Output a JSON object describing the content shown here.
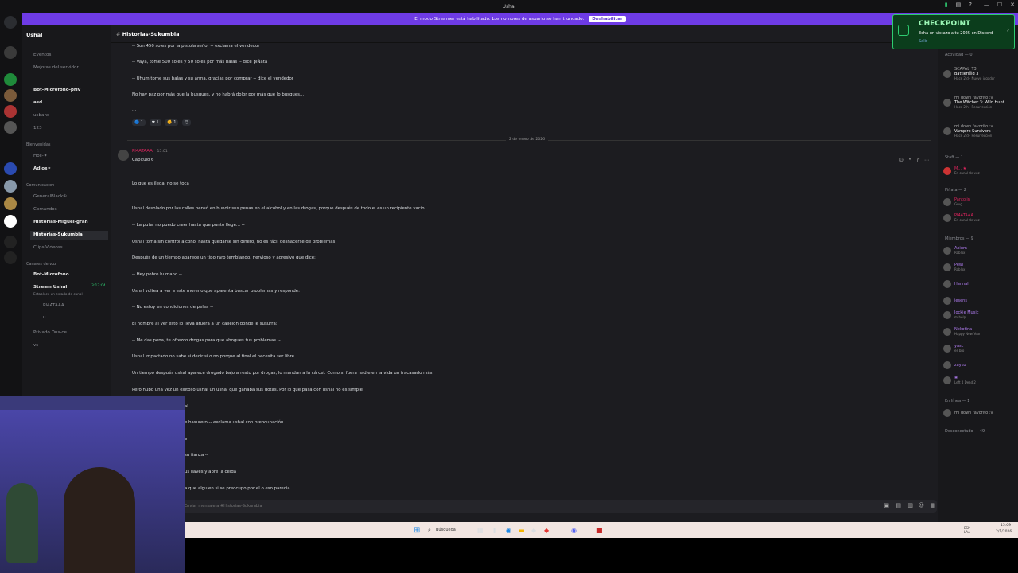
{
  "titlebar": {
    "title": "Ushal"
  },
  "banner": {
    "text": "El modo Streamer está habilitado. Los nombres de usuario se han truncado.",
    "button": "Deshabilitar"
  },
  "server": {
    "name": "Ushal"
  },
  "sidebar": {
    "top": [
      "Eventos",
      "Mejoras del servidor"
    ],
    "channels": [
      "Bot-Microfono-priv",
      "asd",
      "usbans",
      "123"
    ],
    "cat_bienvenidas": "Bienvenidas",
    "bienvenidas": [
      "Holi-✦",
      "Adios✦"
    ],
    "cat_comunicacion": "Comunicacion",
    "comunicacion": [
      "GeneralBlack♔",
      "Comandos",
      "Historias-Miguel-gran",
      "Historias-Sukumbia",
      "Clips-Videoss"
    ],
    "cat_voz": "Canales de voz",
    "voz": [
      "Bot-Microfono",
      "Stream Ushal",
      "Privado Dus-ce",
      "vs"
    ],
    "voz_status": "Establece un estado de canal",
    "voz_users": [
      "PI4ATAAA",
      "u..."
    ],
    "stream_time": "3:17:04"
  },
  "channel": {
    "name": "Historias-Sukumbia",
    "input_placeholder": "Enviar mensaje a #Historias-Sukumbia"
  },
  "messages_top": [
    "-- Son 450 soles por la pistola señor -- exclama el vendedor",
    "-- Vaya, tome 500 soles y 50 soles por más balas -- dice piÑata",
    "-- Uhum tome sus balas y su arma, gracias por comprar -- dice el vendedor",
    "No hay paz por más que la busques, y no habrá dolor por más que lo busques...",
    "..."
  ],
  "reactions": [
    "1",
    "1",
    "1"
  ],
  "date_divider": "2 de enero de 2026",
  "post": {
    "author": "PI4ATAAA",
    "time": "15:01",
    "lines": [
      "Capitulo 6",
      "Lo que es ilegal no se toca",
      "Ushal desolado por las calles pensó en hundir sus penas en el alcohol y en las drogas, porque después de todo el es un recipiente vacio",
      "-- La puta, no puedo creer hasta que punto llege... --",
      "Ushal toma sin control alcohol hasta quedarse sin dinero, no es fácil deshacerse de problemas",
      "Después de un tiempo aparece un tipo raro temblando, nervioso y agresivo que dice:",
      "-- Hey pobre humano --",
      "Ushal voltea a ver a este moreno que aparenta buscar problemas y responde:",
      "-- No estoy en condiciones de pelea --",
      "El hombre al ver esto lo lleva afuera a un callejón donde le susurra:",
      "-- Me das pena, te ofrezco drogas para que ahogues tus problemas --",
      "Ushal impactado no sabe si decir si o no porque al final el necesita ser libre",
      "Un tiempo después ushal aparece drogado bajo arresto por drogas, lo mandan a la cárcel. Como si fuera nadie en la vida un fracasado más.",
      "Pero hubo una vez un exitoso ushal un ushal que ganaba sus dotas. Por lo que pasa con ushal no es simple",
      "al",
      "e basurero -- exclama ushal con preocupación",
      "e:",
      "su fianza --",
      "us llaves y abre la celda",
      "a que alguien si se preocupo por el o eso parecia..."
    ]
  },
  "checkpoint": {
    "title": "CHECKPOINT",
    "subtitle": "Echa un vistazo a tu 2025 en Discord",
    "link": "Salir"
  },
  "members": {
    "activity_header": "Actividad — 0",
    "activity": [
      {
        "name": "SCAPAL_T3",
        "game": "Battlefield 3",
        "sub": "Hace 2 d · Nuevo jugador"
      },
      {
        "name": "mi down favorito :v",
        "game": "The Witcher 3: Wild Hunt",
        "sub": "Hace 2 h · Resurrección"
      },
      {
        "name": "mi down favorito :v",
        "game": "Vampire Survivors",
        "sub": "Hace 2 d · Resurrección"
      }
    ],
    "staff_header": "Staff — 1",
    "staff": [
      {
        "name": "M... ★",
        "sub": "En canal de voz"
      }
    ],
    "pinata_header": "Piñata — 2",
    "pinata": [
      {
        "name": "Pantolin",
        "sub": "Grug"
      },
      {
        "name": "PI4ATAAA",
        "sub": "En canal de voz"
      }
    ],
    "miembros_header": "Miembros — 9",
    "miembros": [
      {
        "name": "Axium",
        "sub": "Roblox"
      },
      {
        "name": "Pewi",
        "sub": "Roblox"
      },
      {
        "name": "Hannah",
        "sub": ""
      },
      {
        "name": "jesens",
        "sub": ""
      },
      {
        "name": "Jockie Music",
        "sub": "m!help"
      },
      {
        "name": "Nekotina",
        "sub": "Happy New Year"
      },
      {
        "name": "yasc",
        "sub": "es bro"
      },
      {
        "name": "zayko",
        "sub": ""
      },
      {
        "name": "❀",
        "sub": "Left 4 Dead 2"
      }
    ],
    "enlinea_header": "En línea — 1",
    "enlinea": [
      {
        "name": "mi down favorito :v",
        "sub": ""
      }
    ],
    "desconectado_header": "Desconectado — 49"
  },
  "taskbar": {
    "search": "Búsqueda",
    "lang": "ESP LAA",
    "time": "15:09",
    "date": "2/1/2026"
  }
}
